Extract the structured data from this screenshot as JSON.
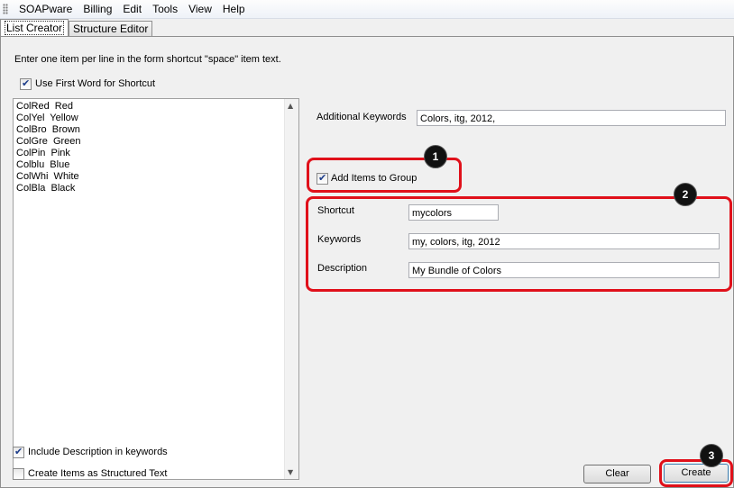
{
  "menu": {
    "items": [
      "SOAPware",
      "Billing",
      "Edit",
      "Tools",
      "View",
      "Help"
    ]
  },
  "tabs": {
    "list_creator": "List Creator",
    "structure_editor": "Structure Editor"
  },
  "instructions": "Enter one item per line in the form shortcut \"space\" item text.",
  "options": {
    "use_first_word": {
      "label": "Use First Word for Shortcut",
      "checked": true
    },
    "include_description": {
      "label": "Include Description in keywords",
      "checked": true
    },
    "structured_text": {
      "label": "Create Items as Structured Text",
      "checked": false
    }
  },
  "list_items": [
    "ColRed  Red",
    "ColYel  Yellow",
    "ColBro  Brown",
    "ColGre  Green",
    "ColPin  Pink",
    "Colblu  Blue",
    "ColWhi  White",
    "ColBla  Black"
  ],
  "additional_keywords": {
    "label": "Additional Keywords",
    "value": "Colors, itg, 2012,"
  },
  "add_to_group": {
    "label": "Add Items to Group",
    "checked": true
  },
  "group": {
    "shortcut": {
      "label": "Shortcut",
      "value": "mycolors"
    },
    "keywords": {
      "label": "Keywords",
      "value": "my, colors, itg, 2012"
    },
    "description": {
      "label": "Description",
      "value": "My Bundle of Colors"
    }
  },
  "buttons": {
    "clear": "Clear",
    "create": "Create"
  },
  "badges": {
    "one": "1",
    "two": "2",
    "three": "3"
  },
  "colors": {
    "callout": "#e0101a",
    "badge": "#111111"
  }
}
